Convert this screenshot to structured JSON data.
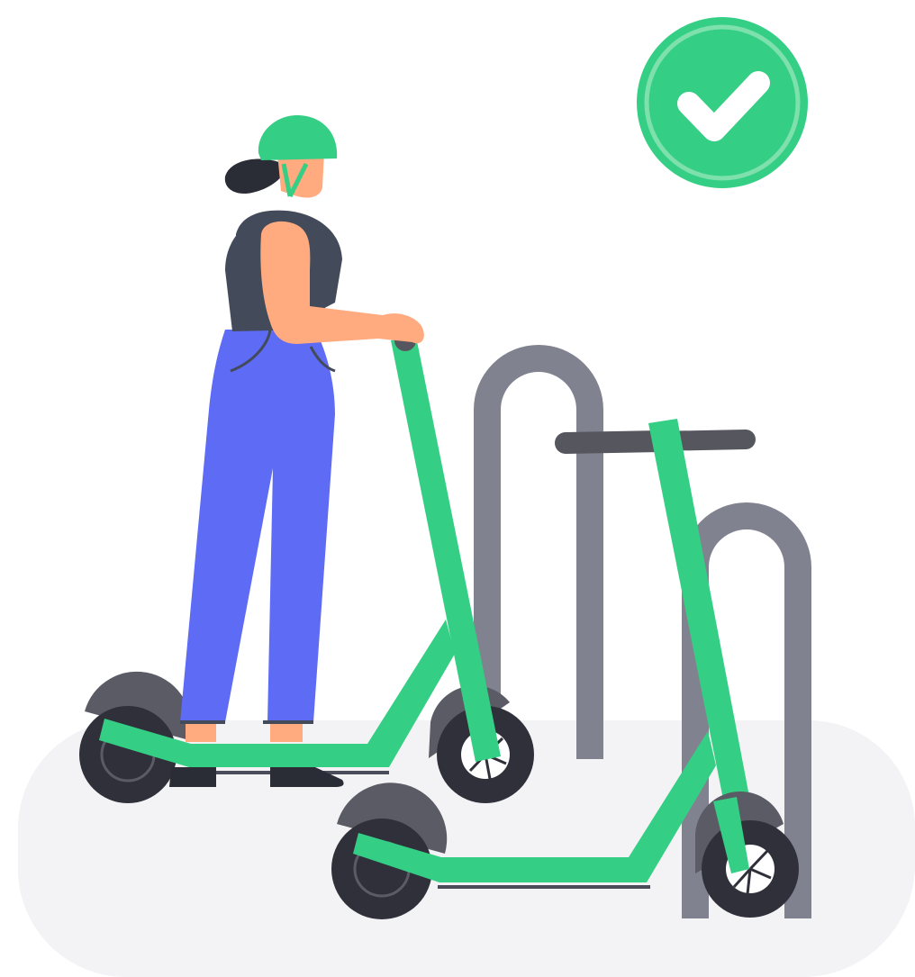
{
  "colors": {
    "background": "#ffffff",
    "ground": "#f3f3f6",
    "scooter_green": "#34cf84",
    "check_ring": "#7ee0ad",
    "rack_gray": "#81828f",
    "handlebar_dark": "#56565f",
    "tire_dark": "#2f303a",
    "fender_gray": "#5b5b66",
    "deck_line": "#4a4c5a",
    "skin": "#ffaa7f",
    "top_dark": "#434b5a",
    "pants_blue": "#5d6bf5",
    "hair_dark": "#2b2d36",
    "check_white": "#ffffff"
  },
  "icons": {
    "badge": "checkmark-icon"
  }
}
